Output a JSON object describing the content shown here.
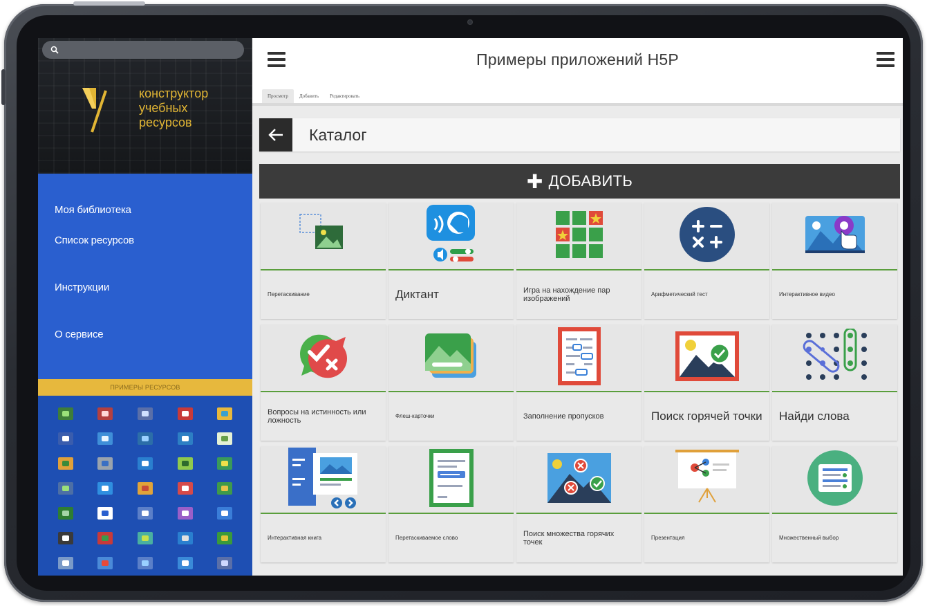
{
  "app": {
    "title": "Примеры приложений H5P"
  },
  "sidebar": {
    "brand_lines": [
      "конструктор",
      "учебных",
      "ресурсов"
    ],
    "nav": [
      {
        "label": "Моя библиотека"
      },
      {
        "label": "Список ресурсов"
      },
      {
        "label": "Инструкции"
      },
      {
        "label": "О сервисе"
      }
    ],
    "examples_label": "ПРИМЕРЫ РЕСУРСОВ",
    "example_icon_count": 35
  },
  "tabs": [
    {
      "label": "Просмотр",
      "active": true
    },
    {
      "label": "Добавить",
      "active": false
    },
    {
      "label": "Редактировать",
      "active": false
    }
  ],
  "catalog": {
    "title": "Каталог",
    "add_label": "ДОБАВИТЬ"
  },
  "cards": [
    {
      "label": "Перетаскивание",
      "size": "s",
      "icon": "drag-drop-icon"
    },
    {
      "label": "Диктант",
      "size": "l",
      "icon": "dictation-icon"
    },
    {
      "label": "Игра на нахождение пар изображений",
      "size": "m",
      "icon": "memory-game-icon"
    },
    {
      "label": "Арифметический тест",
      "size": "s",
      "icon": "arithmetic-icon"
    },
    {
      "label": "Интерактивное видео",
      "size": "s",
      "icon": "interactive-video-icon"
    },
    {
      "label": "Вопросы на истинность или ложность",
      "size": "m",
      "icon": "true-false-icon"
    },
    {
      "label": "Флеш-карточки",
      "size": "s",
      "icon": "flashcards-icon"
    },
    {
      "label": "Заполнение пропусков",
      "size": "m",
      "icon": "fill-blanks-icon"
    },
    {
      "label": "Поиск горячей точки",
      "size": "l",
      "icon": "hotspot-icon"
    },
    {
      "label": "Найди слова",
      "size": "l",
      "icon": "find-words-icon"
    },
    {
      "label": "Интерактивная книга",
      "size": "s",
      "icon": "interactive-book-icon"
    },
    {
      "label": "Перетаскиваемое слово",
      "size": "s",
      "icon": "drag-words-icon"
    },
    {
      "label": "Поиск множества горячих точек",
      "size": "m",
      "icon": "multi-hotspot-icon"
    },
    {
      "label": "Презентация",
      "size": "s",
      "icon": "presentation-icon"
    },
    {
      "label": "Множественный выбор",
      "size": "s",
      "icon": "multiple-choice-icon"
    }
  ],
  "colors": {
    "sidebar_blue": "#2a5fcf",
    "brand_gold": "#e1b534",
    "add_bar": "#3b3b3b",
    "card_accent": "#5a9e3c"
  }
}
